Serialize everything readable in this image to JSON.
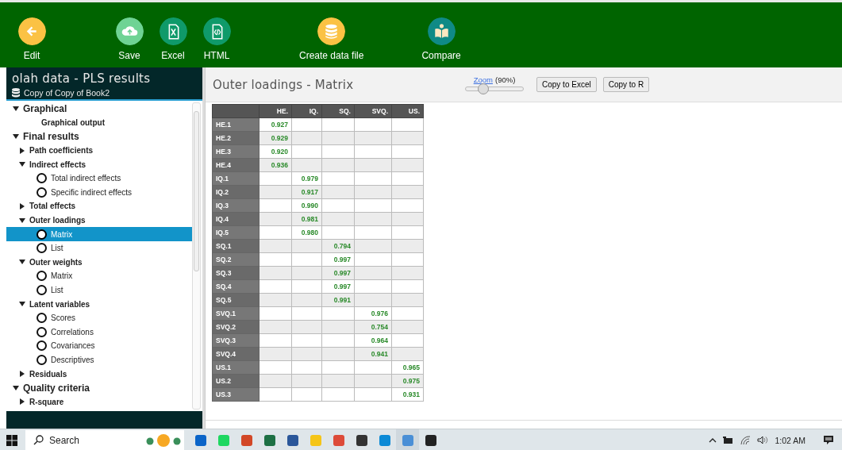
{
  "toolbar": {
    "groups": [
      {
        "buttons": [
          {
            "label": "Edit",
            "color": "#fbc244"
          }
        ]
      },
      {
        "buttons": [
          {
            "label": "Save",
            "color": "#6fd394"
          },
          {
            "label": "Excel",
            "color": "#0f9a6a"
          },
          {
            "label": "HTML",
            "color": "#0f9a6a"
          }
        ]
      },
      {
        "buttons": [
          {
            "label": "Create data file",
            "color": "#fbc244"
          }
        ]
      },
      {
        "buttons": [
          {
            "label": "Compare",
            "color": "#0f8a86"
          }
        ]
      }
    ]
  },
  "sidebar": {
    "title": "olah data - PLS results",
    "dataset": "Copy of Copy of Book2",
    "tree": [
      {
        "label": "Graphical",
        "kind": "section",
        "expanded": true,
        "children": [
          {
            "label": "Graphical output",
            "kind": "link"
          }
        ]
      },
      {
        "label": "Final results",
        "kind": "section",
        "expanded": true,
        "children": [
          {
            "label": "Path coefficients",
            "kind": "group",
            "expanded": false
          },
          {
            "label": "Indirect effects",
            "kind": "group",
            "expanded": true,
            "children": [
              {
                "label": "Total indirect effects",
                "kind": "option",
                "selected": false
              },
              {
                "label": "Specific indirect effects",
                "kind": "option",
                "selected": false
              }
            ]
          },
          {
            "label": "Total effects",
            "kind": "group",
            "expanded": false
          },
          {
            "label": "Outer loadings",
            "kind": "group",
            "expanded": true,
            "children": [
              {
                "label": "Matrix",
                "kind": "option",
                "selected": true
              },
              {
                "label": "List",
                "kind": "option",
                "selected": false
              }
            ]
          },
          {
            "label": "Outer weights",
            "kind": "group",
            "expanded": true,
            "children": [
              {
                "label": "Matrix",
                "kind": "option",
                "selected": false
              },
              {
                "label": "List",
                "kind": "option",
                "selected": false
              }
            ]
          },
          {
            "label": "Latent variables",
            "kind": "group",
            "expanded": true,
            "children": [
              {
                "label": "Scores",
                "kind": "option",
                "selected": false
              },
              {
                "label": "Correlations",
                "kind": "option",
                "selected": false
              },
              {
                "label": "Covariances",
                "kind": "option",
                "selected": false
              },
              {
                "label": "Descriptives",
                "kind": "option",
                "selected": false
              }
            ]
          },
          {
            "label": "Residuals",
            "kind": "group",
            "expanded": false
          }
        ]
      },
      {
        "label": "Quality criteria",
        "kind": "section",
        "expanded": true,
        "children": [
          {
            "label": "R-square",
            "kind": "group",
            "expanded": false
          }
        ]
      }
    ]
  },
  "content": {
    "title": "Outer loadings - Matrix",
    "zoom_link": "Zoom",
    "zoom_value": "(90%)",
    "zoom": {
      "level": 0.3
    },
    "buttons": [
      "Copy to Excel",
      "Copy to R"
    ],
    "table": {
      "columns": [
        "HE.",
        "IQ.",
        "SQ.",
        "SVQ.",
        "US."
      ],
      "rows": [
        {
          "label": "HE.1",
          "he": "0.927"
        },
        {
          "label": "HE.2",
          "he": "0.929"
        },
        {
          "label": "HE.3",
          "he": "0.920"
        },
        {
          "label": "HE.4",
          "he": "0.936"
        },
        {
          "label": "IQ.1",
          "iq": "0.979"
        },
        {
          "label": "IQ.2",
          "iq": "0.917"
        },
        {
          "label": "IQ.3",
          "iq": "0.990"
        },
        {
          "label": "IQ.4",
          "iq": "0.981"
        },
        {
          "label": "IQ.5",
          "iq": "0.980"
        },
        {
          "label": "SQ.1",
          "sq": "0.794"
        },
        {
          "label": "SQ.2",
          "sq": "0.997"
        },
        {
          "label": "SQ.3",
          "sq": "0.997"
        },
        {
          "label": "SQ.4",
          "sq": "0.997"
        },
        {
          "label": "SQ.5",
          "sq": "0.991"
        },
        {
          "label": "SVQ.1",
          "svq": "0.976"
        },
        {
          "label": "SVQ.2",
          "svq": "0.754"
        },
        {
          "label": "SVQ.3",
          "svq": "0.964"
        },
        {
          "label": "SVQ.4",
          "svq": "0.941"
        },
        {
          "label": "US.1",
          "us": "0.965"
        },
        {
          "label": "US.2",
          "us": "0.975"
        },
        {
          "label": "US.3",
          "us": "0.931"
        }
      ]
    }
  },
  "taskbar": {
    "search": {
      "placeholder": "Search"
    },
    "apps": [
      {
        "color": "#0a64c8"
      },
      {
        "color": "#1ed760"
      },
      {
        "color": "#d24726"
      },
      {
        "color": "#1d7044"
      },
      {
        "color": "#2b579a"
      },
      {
        "color": "#f5c518"
      },
      {
        "color": "#dd4b39"
      },
      {
        "color": "#333333"
      },
      {
        "color": "#0c8ad6"
      },
      {
        "color": "#4a8fd6",
        "selected": true
      },
      {
        "color": "#222222"
      }
    ],
    "time": "1:02 AM"
  }
}
